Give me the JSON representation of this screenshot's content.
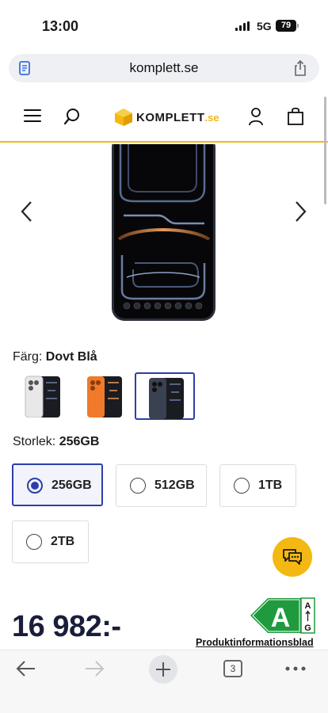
{
  "status_bar": {
    "time": "13:00",
    "network": "5G",
    "battery": "79"
  },
  "browser": {
    "url": "komplett.se",
    "tab_count": "3"
  },
  "site": {
    "logo_text": "KOMPLETT",
    "logo_suffix": ".se",
    "accent_color": "#f3b912"
  },
  "product": {
    "color_label": "Färg:",
    "color_value": "Dovt Blå",
    "color_swatches": [
      {
        "name": "white",
        "selected": false
      },
      {
        "name": "orange",
        "selected": false
      },
      {
        "name": "blue",
        "selected": true
      }
    ],
    "size_label": "Storlek:",
    "size_value": "256GB",
    "sizes": [
      {
        "label": "256GB",
        "selected": true
      },
      {
        "label": "512GB",
        "selected": false
      },
      {
        "label": "1TB",
        "selected": false
      },
      {
        "label": "2TB",
        "selected": false
      }
    ],
    "price": "16 982:-",
    "energy_class": "A",
    "energy_scale_top": "A",
    "energy_scale_bottom": "G",
    "product_info_link": "Produktinformationsblad"
  }
}
